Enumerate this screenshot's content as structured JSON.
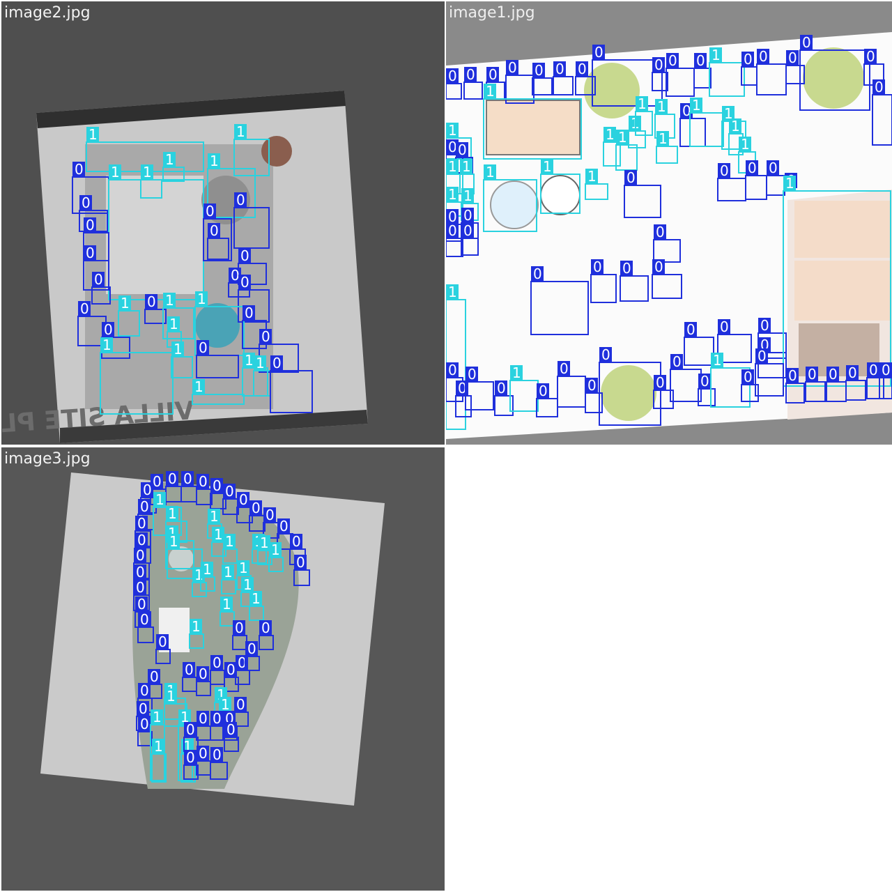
{
  "colors": {
    "class_0": "#1f2fdc",
    "class_1": "#2ad2df",
    "canvas_dark": "#4e4e4e",
    "canvas_mid": "#5a5a5a",
    "sheet": "#c8c8c8"
  },
  "tiles": [
    {
      "id": "tile-image2",
      "title": "image2.jpg"
    },
    {
      "id": "tile-image1",
      "title": "image1.jpg"
    },
    {
      "id": "tile-image3",
      "title": "image3.jpg"
    }
  ],
  "watermark": "VILLA SITE PLAN",
  "class_labels": [
    "0",
    "1"
  ]
}
